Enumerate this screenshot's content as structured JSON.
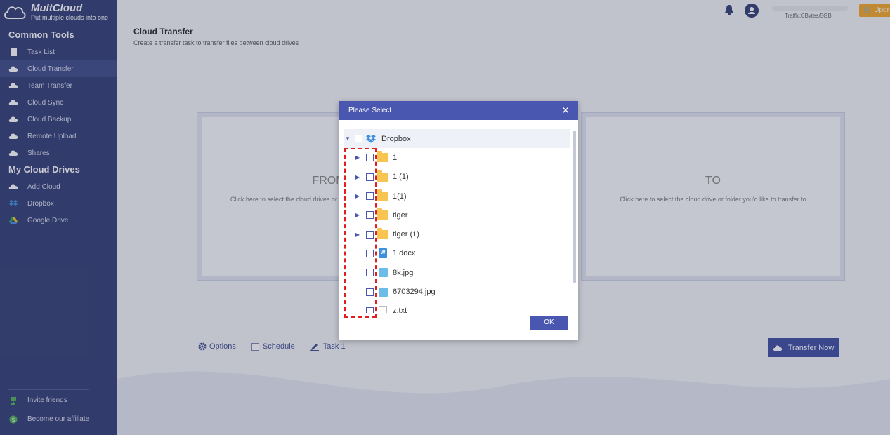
{
  "brand": {
    "name": "MultCloud",
    "tagline": "Put multiple clouds into one"
  },
  "sidebar": {
    "common_tools_title": "Common Tools",
    "common_tools": [
      {
        "label": "Task List",
        "icon": "clipboard-icon"
      },
      {
        "label": "Cloud Transfer",
        "icon": "cloud-transfer-icon",
        "active": true
      },
      {
        "label": "Team Transfer",
        "icon": "team-transfer-icon"
      },
      {
        "label": "Cloud Sync",
        "icon": "cloud-sync-icon"
      },
      {
        "label": "Cloud Backup",
        "icon": "cloud-backup-icon"
      },
      {
        "label": "Remote Upload",
        "icon": "remote-upload-icon"
      },
      {
        "label": "Shares",
        "icon": "share-icon"
      }
    ],
    "my_drives_title": "My Cloud Drives",
    "drives": [
      {
        "label": "Add Cloud",
        "icon": "add-cloud-icon"
      },
      {
        "label": "Dropbox",
        "icon": "dropbox-icon"
      },
      {
        "label": "Google Drive",
        "icon": "google-drive-icon"
      }
    ],
    "bottom": [
      {
        "label": "Invite friends",
        "icon": "trophy-icon"
      },
      {
        "label": "Become our affiliate",
        "icon": "dollar-icon"
      }
    ]
  },
  "topbar": {
    "traffic": "Traffic:0Bytes/5GB",
    "upgrade": "Upgr"
  },
  "page": {
    "title": "Cloud Transfer",
    "subtitle": "Create a transfer task to transfer files between cloud drives"
  },
  "from_panel": {
    "heading": "FROM",
    "hint": "Click here to select the cloud drives or folder you'd like to transfer from"
  },
  "to_panel": {
    "heading": "TO",
    "hint": "Click here to select the cloud drive or folder you'd like to transfer to"
  },
  "bottombar": {
    "options": "Options",
    "schedule": "Schedule",
    "task": "Task 1",
    "transfer_now": "Transfer Now"
  },
  "modal": {
    "title": "Please Select",
    "ok": "OK",
    "root": "Dropbox",
    "items": [
      {
        "name": "1",
        "type": "folder"
      },
      {
        "name": "1 (1)",
        "type": "folder"
      },
      {
        "name": "1(1)",
        "type": "folder"
      },
      {
        "name": "tiger",
        "type": "folder"
      },
      {
        "name": "tiger (1)",
        "type": "folder"
      },
      {
        "name": "1.docx",
        "type": "docx"
      },
      {
        "name": "8k.jpg",
        "type": "jpg"
      },
      {
        "name": "6703294.jpg",
        "type": "jpg"
      },
      {
        "name": "z.txt",
        "type": "txt"
      }
    ]
  },
  "colors": {
    "sidebar": "#2f3b72",
    "accent": "#4a57b0",
    "highlight": "#e02020",
    "upgrade": "#f5a623"
  }
}
